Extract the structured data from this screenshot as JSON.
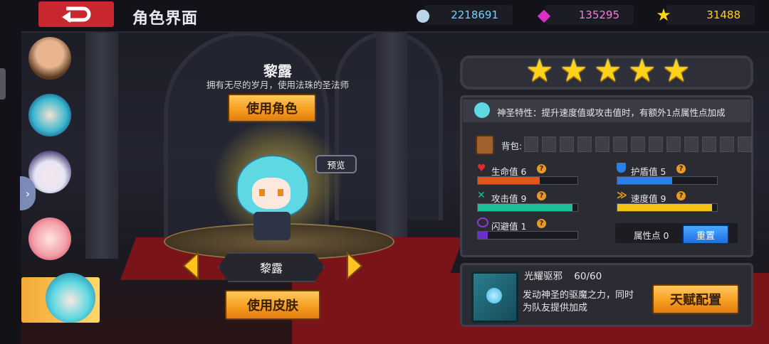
{
  "header": {
    "title": "角色界面",
    "resources": [
      {
        "icon": "silver-coin-icon",
        "value": "2218691",
        "color": "#6fd3ff"
      },
      {
        "icon": "purple-gem-icon",
        "value": "135295",
        "color": "#ff78d6"
      },
      {
        "icon": "gold-star-icon",
        "value": "31488",
        "color": "#ffd21a"
      }
    ]
  },
  "character": {
    "name": "黎露",
    "description": "拥有无尽的岁月，使用法珠的圣法师",
    "use_character_label": "使用角色",
    "use_skin_label": "使用皮肤",
    "preview_label": "预览",
    "plate_name": "黎露",
    "stars": 5
  },
  "trait": {
    "text": "神圣特性：提升速度值或攻击值时，有额外1点属性点加成"
  },
  "bag": {
    "label": "背包:"
  },
  "stats": {
    "hp": {
      "label": "生命值 6",
      "value": 6,
      "fill": 0.62,
      "color": "#e6531c"
    },
    "shield": {
      "label": "护盾值 5",
      "value": 5,
      "fill": 0.55,
      "color": "#2c7fe6"
    },
    "attack": {
      "label": "攻击值 9",
      "value": 9,
      "fill": 0.95,
      "color": "#1bbf9a"
    },
    "speed": {
      "label": "速度值 9",
      "value": 9,
      "fill": 0.95,
      "color": "#f2c310"
    },
    "dodge": {
      "label": "闪避值 1",
      "value": 1,
      "fill": 0.1,
      "color": "#6a2fcf"
    },
    "attr_points_label": "属性点 0",
    "reset_label": "重置"
  },
  "talent": {
    "title": "光耀驱邪",
    "progress": "60/60",
    "description_line1": "发动神圣的驱魔之力，同时",
    "description_line2": "为队友提供加成",
    "config_label": "天赋配置"
  }
}
